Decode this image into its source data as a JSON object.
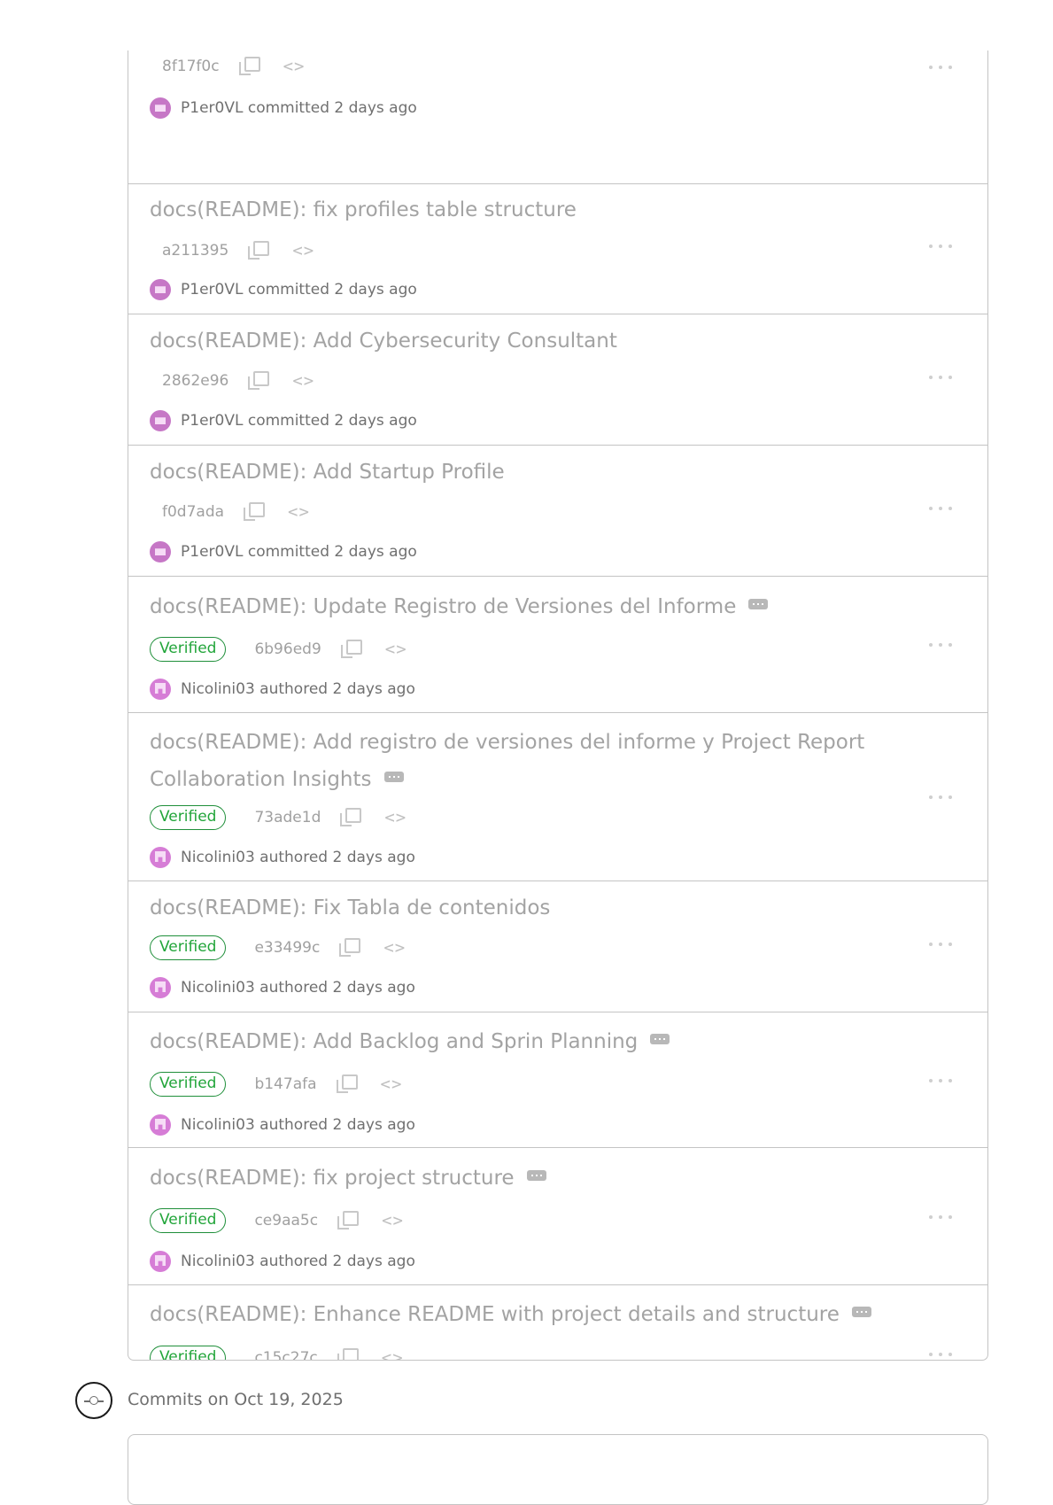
{
  "commits": [
    {
      "title": "",
      "verified": false,
      "hash": "8f17f0c",
      "author": "P1er0VL",
      "action": "committed",
      "time": "2 days ago",
      "has_more": false
    },
    {
      "title": "docs(README): fix profiles table structure",
      "verified": false,
      "hash": "a211395",
      "author": "P1er0VL",
      "action": "committed",
      "time": "2 days ago",
      "has_more": false
    },
    {
      "title": "docs(README): Add Cybersecurity Consultant",
      "verified": false,
      "hash": "2862e96",
      "author": "P1er0VL",
      "action": "committed",
      "time": "2 days ago",
      "has_more": false
    },
    {
      "title": "docs(README): Add Startup Profile",
      "verified": false,
      "hash": "f0d7ada",
      "author": "P1er0VL",
      "action": "committed",
      "time": "2 days ago",
      "has_more": false
    },
    {
      "title": "docs(README): Update Registro de Versiones del Informe",
      "verified": true,
      "hash": "6b96ed9",
      "author": "Nicolini03",
      "action": "authored",
      "time": "2 days ago",
      "has_more": true
    },
    {
      "title": "docs(README): Add registro de versiones del informe y Project Report",
      "title_line2": "Collaboration Insights",
      "verified": true,
      "hash": "73ade1d",
      "author": "Nicolini03",
      "action": "authored",
      "time": "2 days ago",
      "has_more": true
    },
    {
      "title": "docs(README): Fix Tabla de contenidos",
      "verified": true,
      "hash": "e33499c",
      "author": "Nicolini03",
      "action": "authored",
      "time": "2 days ago",
      "has_more": false
    },
    {
      "title": "docs(README): Add Backlog and Sprin Planning",
      "verified": true,
      "hash": "b147afa",
      "author": "Nicolini03",
      "action": "authored",
      "time": "2 days ago",
      "has_more": true
    },
    {
      "title": "docs(README): fix project structure",
      "verified": true,
      "hash": "ce9aa5c",
      "author": "Nicolini03",
      "action": "authored",
      "time": "2 days ago",
      "has_more": true
    },
    {
      "title": "docs(README): Enhance README with project details and structure",
      "verified": true,
      "hash": "c15c27c",
      "author": "Nicolini03",
      "action": "authored",
      "time": "2 days ago",
      "has_more": true
    }
  ],
  "verified_label": "Verified",
  "code_glyph": "<>",
  "group_header": "Commits on Oct 19, 2025",
  "icons": {
    "copy": "copy-icon",
    "code": "code-icon",
    "more": "kebab-icon",
    "avatar": "user-avatar",
    "timeline": "git-commit-icon"
  },
  "colors": {
    "verified": "#1f8f3a",
    "avatar": "#d67dd6",
    "border": "#c4c4c4"
  }
}
